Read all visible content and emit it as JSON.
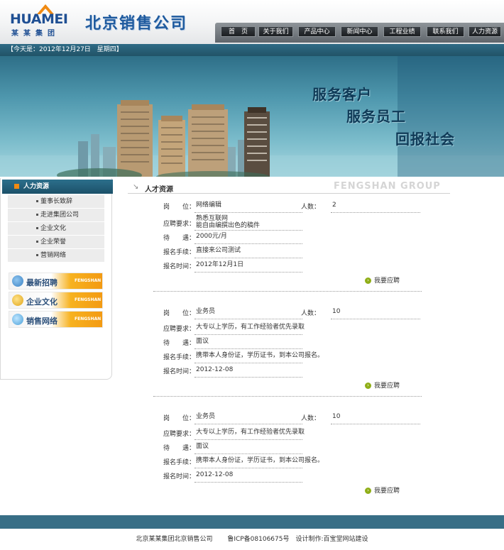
{
  "header": {
    "logo_text": "HUAMEI",
    "logo_sub": "某某集团",
    "company": "北京销售公司"
  },
  "nav": [
    "首　页",
    "关于我们",
    "产品中心",
    "新闻中心",
    "工程业绩",
    "联系我们",
    "人力资源"
  ],
  "date_text": "【今天是：2012年12月27日　星期四】",
  "banner": {
    "slogans": [
      "服务客户",
      "服务员工",
      "回报社会"
    ]
  },
  "sidebar": {
    "title": "人力资源",
    "links": [
      "董事长致辞",
      "走进集团公司",
      "企业文化",
      "企业荣誉",
      "营销网络"
    ],
    "promos": [
      {
        "label": "最新招聘",
        "tag": "FENGSHAN",
        "icon_color": "#3b82c4"
      },
      {
        "label": "企业文化",
        "tag": "FENGSHAN",
        "icon_color": "#e0a418"
      },
      {
        "label": "销售网络",
        "tag": "FENGSHAN",
        "icon_color": "#4a9fd8"
      }
    ]
  },
  "main": {
    "title": "人才资源",
    "group_text": "FENGSHAN GROUP"
  },
  "labels": {
    "position": "岗　　位：",
    "requirements": "应聘要求：",
    "salary": "待　　遇：",
    "procedure": "报名手续：",
    "date": "报名时间：",
    "count": "人数：",
    "apply": "我要应聘"
  },
  "jobs": [
    {
      "position": "网络编辑",
      "count": "2",
      "requirements": [
        "熟悉互联网",
        "能自由编撰出色的稿件"
      ],
      "salary": "2000元/月",
      "procedure": "直接来公司测试",
      "date": "2012年12月1日"
    },
    {
      "position": "业务员",
      "count": "10",
      "requirements": [
        "大专以上学历，有工作经验者优先录取"
      ],
      "salary": "面议",
      "procedure": "携带本人身份证，学历证书，到本公司报名。",
      "date": "2012-12-08"
    },
    {
      "position": "业务员",
      "count": "10",
      "requirements": [
        "大专以上学历，有工作经验者优先录取"
      ],
      "salary": "面议",
      "procedure": "携带本人身份证，学历证书，到本公司报名。",
      "date": "2012-12-08"
    }
  ],
  "footer": "北京某某集团北京销售公司　　 鲁ICP备08106675号　设计制作:百宝堂网站建设",
  "colors": {
    "nav_dark": "#1b1e21",
    "bar_blue": "#386e86",
    "accent_orange": "#f39a12"
  }
}
